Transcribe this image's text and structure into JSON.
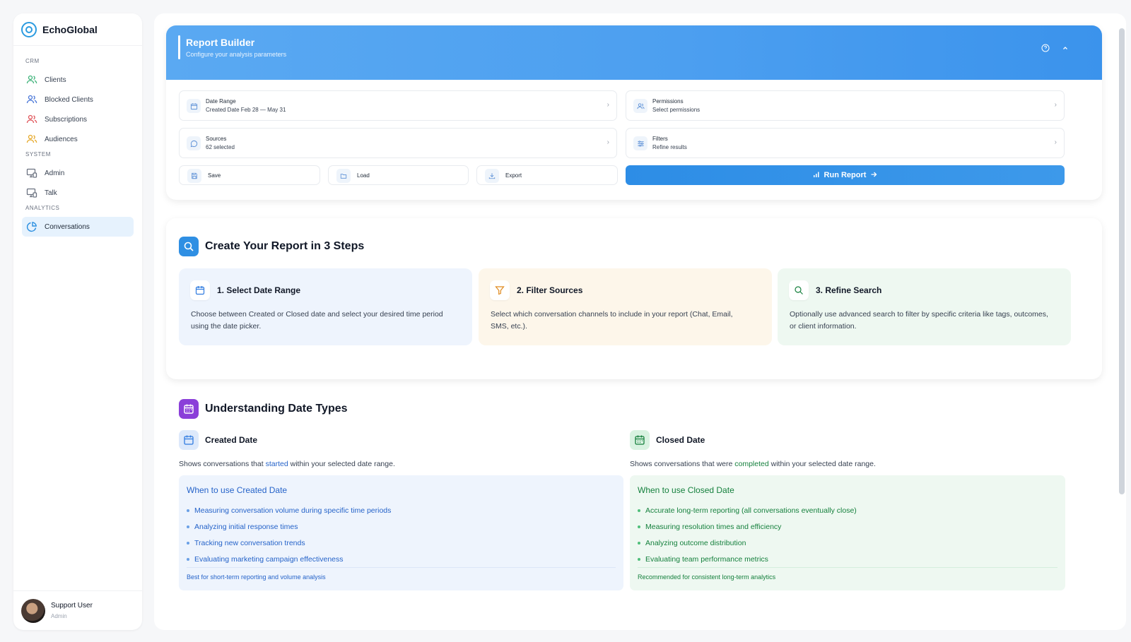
{
  "brand": {
    "name": "EchoGlobal"
  },
  "sidebar": {
    "sections": [
      {
        "label": "CRM"
      },
      {
        "label": "SYSTEM"
      },
      {
        "label": "ANALYTICS"
      }
    ],
    "items": [
      {
        "label": "Clients",
        "icon": "users-icon"
      },
      {
        "label": "Blocked Clients",
        "icon": "users-blocked-icon"
      },
      {
        "label": "Subscriptions",
        "icon": "subscriptions-icon"
      },
      {
        "label": "Audiences",
        "icon": "audiences-icon"
      },
      {
        "label": "Admin",
        "icon": "monitor-icon"
      },
      {
        "label": "Talk",
        "icon": "monitor-talk-icon"
      },
      {
        "label": "Conversations",
        "icon": "pie-chart-icon",
        "active": true
      }
    ],
    "user": {
      "name": "Support User",
      "role": "Admin"
    }
  },
  "builder": {
    "title": "Report Builder",
    "subtitle": "Configure your analysis parameters",
    "fields": {
      "date_range": {
        "label": "Date Range",
        "value": "Created Date Feb 28 — May 31"
      },
      "permissions": {
        "label": "Permissions",
        "value": "Select permissions"
      },
      "sources": {
        "label": "Sources",
        "value": "62 selected"
      },
      "filters": {
        "label": "Filters",
        "value": "Refine results"
      }
    },
    "actions": {
      "save": "Save",
      "load": "Load",
      "export": "Export",
      "run": "Run Report"
    }
  },
  "steps": {
    "title": "Create Your Report in 3 Steps",
    "items": [
      {
        "title": "1. Select Date Range",
        "desc": "Choose between Created or Closed date and select your desired time period using the date picker.",
        "icon": "calendar-icon",
        "bg": "#eef4fd"
      },
      {
        "title": "2. Filter Sources",
        "desc": "Select which conversation channels to include in your report (Chat, Email, SMS, etc.).",
        "icon": "filter-icon",
        "bg": "#fdf6ea"
      },
      {
        "title": "3. Refine Search",
        "desc": "Optionally use advanced search to filter by specific criteria like tags, outcomes, or client information.",
        "icon": "search-icon",
        "bg": "#eef8f1"
      }
    ]
  },
  "date_types": {
    "title": "Understanding Date Types",
    "created": {
      "title": "Created Date",
      "desc_pre": "Shows conversations that ",
      "desc_kw": "started",
      "desc_post": " within your selected date range.",
      "box_title": "When to use Created Date",
      "items": [
        "Measuring conversation volume during specific time periods",
        "Analyzing initial response times",
        "Tracking new conversation trends",
        "Evaluating marketing campaign effectiveness"
      ],
      "footer": "Best for short-term reporting and volume analysis",
      "color": "#2563c9",
      "bg": "#eef4fd"
    },
    "closed": {
      "title": "Closed Date",
      "desc_pre": "Shows conversations that were ",
      "desc_kw": "completed",
      "desc_post": " within your selected date range.",
      "box_title": "When to use Closed Date",
      "items": [
        "Accurate long-term reporting (all conversations eventually close)",
        "Measuring resolution times and efficiency",
        "Analyzing outcome distribution",
        "Evaluating team performance metrics"
      ],
      "footer": "Recommended for consistent long-term analytics",
      "color": "#15803d",
      "bg": "#eef8f1"
    }
  },
  "colors": {
    "accent": "#2b9be0",
    "run_button": "#2d8de6",
    "purple": "#8b3fd9"
  }
}
